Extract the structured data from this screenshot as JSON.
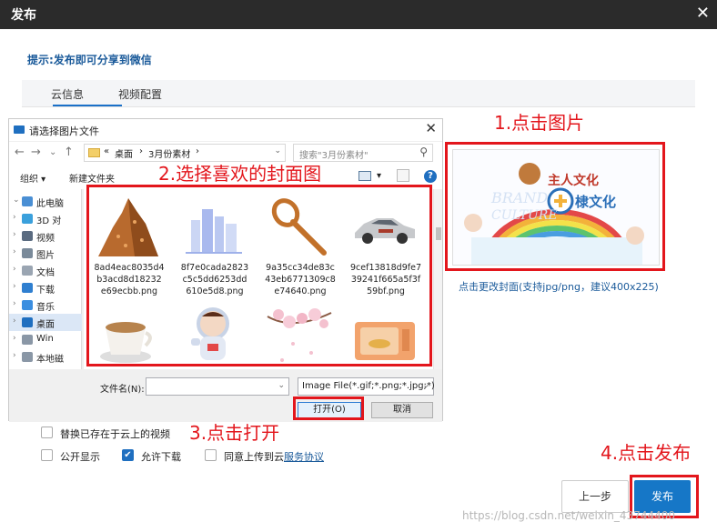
{
  "window": {
    "title": "发布",
    "close_glyph": "✕"
  },
  "tip": "提示:发布即可分享到微信",
  "tabs": [
    {
      "label": "云信息",
      "active": true
    },
    {
      "label": "视频配置",
      "active": false
    }
  ],
  "file_dialog": {
    "title": "请选择图片文件",
    "close_glyph": "✕",
    "nav": {
      "back": "←",
      "forward": "→",
      "up_dropdown": "⌄",
      "up": "↑"
    },
    "address": {
      "prefix": "«",
      "crumbs": [
        "桌面",
        "3月份素材"
      ],
      "separator": "›",
      "dropdown": "⌄"
    },
    "refresh_glyph": "↻",
    "search_placeholder": "搜索\"3月份素材\"",
    "search_icon": "⚲",
    "toolbar": {
      "organize": "组织 ▾",
      "new_folder": "新建文件夹",
      "view_dropdown": "▾",
      "help": "?"
    },
    "sidebar": [
      {
        "label": "此电脑",
        "icon": "computer-icon",
        "expanded": true
      },
      {
        "label": "3D 对",
        "icon": "3d-objects-icon"
      },
      {
        "label": "视频",
        "icon": "videos-icon"
      },
      {
        "label": "图片",
        "icon": "pictures-icon"
      },
      {
        "label": "文档",
        "icon": "documents-icon"
      },
      {
        "label": "下载",
        "icon": "downloads-icon"
      },
      {
        "label": "音乐",
        "icon": "music-icon"
      },
      {
        "label": "桌面",
        "icon": "desktop-icon",
        "selected": true
      },
      {
        "label": "Win",
        "icon": "drive-icon"
      },
      {
        "label": "本地磁",
        "icon": "drive-icon"
      }
    ],
    "files": [
      {
        "name_lines": [
          "8ad4eac8035d4",
          "b3acd8d18232",
          "e69ecbb.png"
        ],
        "thumb": "mountain-thumbnail"
      },
      {
        "name_lines": [
          "8f7e0cada2823",
          "c5c5dd6253dd",
          "610e5d8.png"
        ],
        "thumb": "city-buildings-thumbnail"
      },
      {
        "name_lines": [
          "9a35cc34de83c",
          "43eb6771309c8",
          "e74640.png"
        ],
        "thumb": "wooden-spoon-thumbnail"
      },
      {
        "name_lines": [
          "9cef13818d9fe7",
          "39241f665a5f3f",
          "59bf.png"
        ],
        "thumb": "car-thumbnail"
      },
      {
        "name_lines": [],
        "thumb": "coffee-cup-thumbnail"
      },
      {
        "name_lines": [],
        "thumb": "astronaut-thumbnail"
      },
      {
        "name_lines": [],
        "thumb": "cherry-blossom-thumbnail"
      },
      {
        "name_lines": [],
        "thumb": "microwave-thumbnail"
      }
    ],
    "filename_label": "文件名(N):",
    "filename_value": "",
    "filetype_value": "Image File(*.gif;*.png;*.jpg;*)",
    "dropdown_glyph": "⌄",
    "open_label": "打开(O)",
    "cancel_label": "取消"
  },
  "annotations": {
    "step1": "1.点击图片",
    "step2": "2.选择喜欢的封面图",
    "step3": "3.点击打开",
    "step4": "4.点击发布"
  },
  "cover": {
    "title_text": "主人文化",
    "bottom_text": "棣文化",
    "brand_text": "BRAND",
    "culture_text": "CULTURE",
    "change_link": "点击更改封面(支持jpg/png，建议400x225)"
  },
  "options": {
    "replace_label": "替换已存在于云上的视频",
    "replace_checked": false,
    "public_label": "公开显示",
    "public_checked": false,
    "download_label": "允许下载",
    "download_checked": true,
    "agree_label": "同意上传到云",
    "agree_checked": false,
    "protocol_link": "服务协议",
    "check_glyph": "✔"
  },
  "buttons": {
    "prev": "上一步",
    "publish": "发布"
  },
  "watermark": "https://blog.csdn.net/weixin_43744400",
  "colors": {
    "annotation_red": "#e3161c",
    "primary_blue": "#1677c7",
    "topbar": "#2b2b2b"
  }
}
